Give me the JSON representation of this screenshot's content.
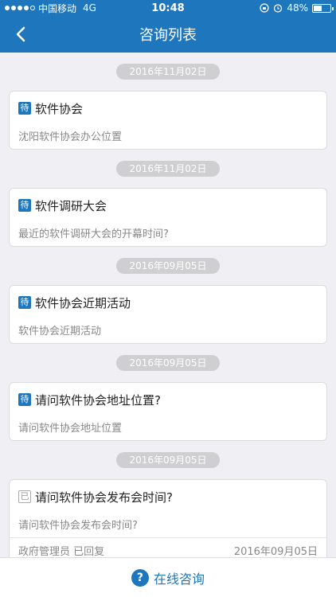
{
  "status_bar": {
    "carrier": "中国移动",
    "network": "4G",
    "time": "10:48",
    "battery": "48%",
    "battery_level": 0.48
  },
  "nav": {
    "title": "咨询列表",
    "back_icon": "chevron-left-icon"
  },
  "colors": {
    "brand": "#1e76bd",
    "background": "#efeff4"
  },
  "items": [
    {
      "date": "2016年11月02日",
      "badge": "待",
      "title": "软件协会",
      "subtitle": "沈阳软件协会办公位置"
    },
    {
      "date": "2016年11月02日",
      "badge": "待",
      "title": "软件调研大会",
      "subtitle": "最近的软件调研大会的开幕时间?"
    },
    {
      "date": "2016年09月05日",
      "badge": "待",
      "title": "软件协会近期活动",
      "subtitle": "软件协会近期活动"
    },
    {
      "date": "2016年09月05日",
      "badge": "待",
      "title": "请问软件协会地址位置?",
      "subtitle": "请问软件协会地址位置"
    },
    {
      "date": "2016年09月05日",
      "badge": "已",
      "title": "请问软件协会发布会时间?",
      "subtitle": "请问软件协会发布会时间?",
      "footer_left": "政府管理员 已回复",
      "footer_right": "2016年09月05日"
    }
  ],
  "bottom": {
    "label": "在线咨询",
    "icon": "question-circle-icon",
    "icon_glyph": "?"
  }
}
